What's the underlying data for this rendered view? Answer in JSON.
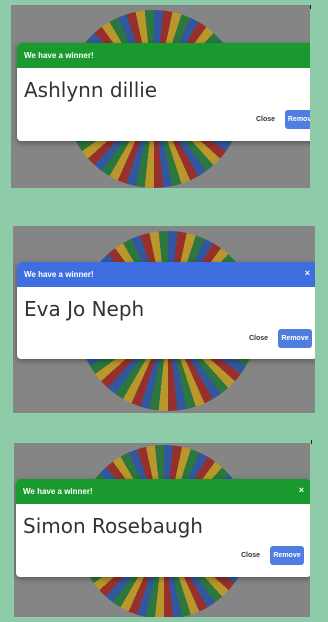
{
  "colors": {
    "page_bg": "#8ecba9",
    "overlay": "#858585",
    "green_header": "#1a9a2e",
    "blue_header": "#3f6ee0",
    "remove_button": "#4f7ee0"
  },
  "panels": [
    {
      "header_color": "#1a9a2e",
      "header_text": "We have a winner!",
      "close_icon": "×",
      "winner_name": "Ashlynn dillie",
      "close_label": "Close",
      "remove_label": "Remove"
    },
    {
      "header_color": "#3f6ee0",
      "header_text": "We have a winner!",
      "close_icon": "×",
      "winner_name": "Eva Jo Neph",
      "close_label": "Close",
      "remove_label": "Remove"
    },
    {
      "header_color": "#1a9a2e",
      "header_text": "We have a winner!",
      "close_icon": "×",
      "winner_name": "Simon Rosebaugh",
      "close_label": "Close",
      "remove_label": "Remove"
    }
  ]
}
